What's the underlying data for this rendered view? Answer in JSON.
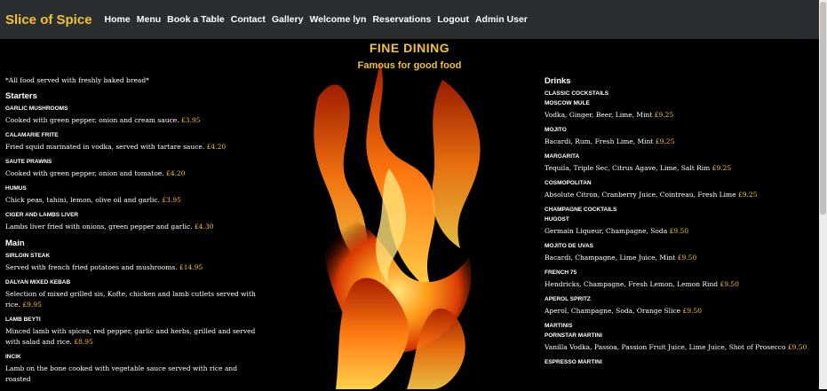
{
  "navbar": {
    "brand": "Slice of Spice",
    "links": [
      "Home",
      "Menu",
      "Book a Table",
      "Contact",
      "Gallery",
      "Welcome lyn",
      "Reservations",
      "Logout",
      "Admin User"
    ]
  },
  "hero": {
    "title": "FINE DINING",
    "subtitle": "Famous for good food"
  },
  "food": {
    "note": "*All food served with freshly baked bread*",
    "sections": [
      {
        "title": "Starters",
        "items": [
          {
            "name": "GARLIC MUSHROOMS",
            "desc": "Cooked with green pepper, onion and cream sauce.",
            "price": "£3.95"
          },
          {
            "name": "CALAMARIE FRITE",
            "desc": "Fried squid marinated in vodka, served with tartare sauce.",
            "price": "£4.20"
          },
          {
            "name": "SAUTE PRAWNS",
            "desc": "Cooked with green pepper, onion and tomatoe.",
            "price": "£4.20"
          },
          {
            "name": "HUMUS",
            "desc": "Chick peas, tahini, lemon, olive oil and garlic.",
            "price": "£3.95"
          },
          {
            "name": "CIGER AND LAMBS LIVER",
            "desc": "Lambs liver fried with onions, green pepper and garlic.",
            "price": "£4.30"
          }
        ]
      },
      {
        "title": "Main",
        "items": [
          {
            "name": "SIRLOIN STEAK",
            "desc": "Served with french fried potatoes and mushrooms.",
            "price": "£14.95"
          },
          {
            "name": "DALYAN MIXED KEBAB",
            "desc": "Selection of mixed grilled sis, Kofte, chicken and lamb cutlets served with rice.",
            "price": "£9.95"
          },
          {
            "name": "LAMB BEYTI",
            "desc": "Minced lamb with spices, red pepper, garlic and herbs, grilled and served with salad and rice.",
            "price": "£8.95"
          },
          {
            "name": "INCIK",
            "desc": "Lamb on the bone cooked with vegetable sauce served with rice and roasted",
            "price": ""
          }
        ]
      }
    ]
  },
  "drinks": {
    "title": "Drinks",
    "groups": [
      {
        "title": "CLASSIC COCKSTAILS",
        "items": [
          {
            "name": "MOSCOW MULE",
            "desc": "Vodka, Ginger, Beer, Lime, Mint",
            "price": "£9.25"
          },
          {
            "name": "MOJITO",
            "desc": "Bacardi, Rum, Fresh Lime, Mint",
            "price": "£9.25"
          },
          {
            "name": "MARGARITA",
            "desc": "Tequila, Triple Sec, Citrus Agave, Lime, Salt Rim",
            "price": "£9.25"
          },
          {
            "name": "COSMOPOLITAN",
            "desc": "Absolute Citron, Cranberry Juice, Cointreau, Fresh Lime",
            "price": "£9.25"
          }
        ]
      },
      {
        "title": "CHAMPAGNE COCKTAILS",
        "items": [
          {
            "name": "HUGOST",
            "desc": "Germain Liqueur, Champagne, Soda",
            "price": "£9.50"
          },
          {
            "name": "MOJITO DE UVAS",
            "desc": "Bacardi, Champagne, Lime Juice, Mint",
            "price": "£9.50"
          },
          {
            "name": "FRENCH 75",
            "desc": "Hendricks, Champagne, Fresh Lemon, Lemon Rind",
            "price": "£9.50"
          },
          {
            "name": "APEROL SPRITZ",
            "desc": "Aperol, Champagne, Soda, Orange Slice",
            "price": "£9.50"
          }
        ]
      },
      {
        "title": "MARTINIS",
        "items": [
          {
            "name": "PORNSTAR MARTINI",
            "desc": "Vanilla Vodka, Passoa, Passion Fruit Juice, Lime Juice, Shot of Prosecco",
            "price": "£9.50"
          },
          {
            "name": "ESPRESSO MARTINI",
            "desc": "",
            "price": ""
          }
        ]
      }
    ]
  },
  "colors": {
    "accent": "#f2c230",
    "navbar": "#2b2e31",
    "background": "#000000"
  },
  "icons": [
    "flame-image"
  ]
}
